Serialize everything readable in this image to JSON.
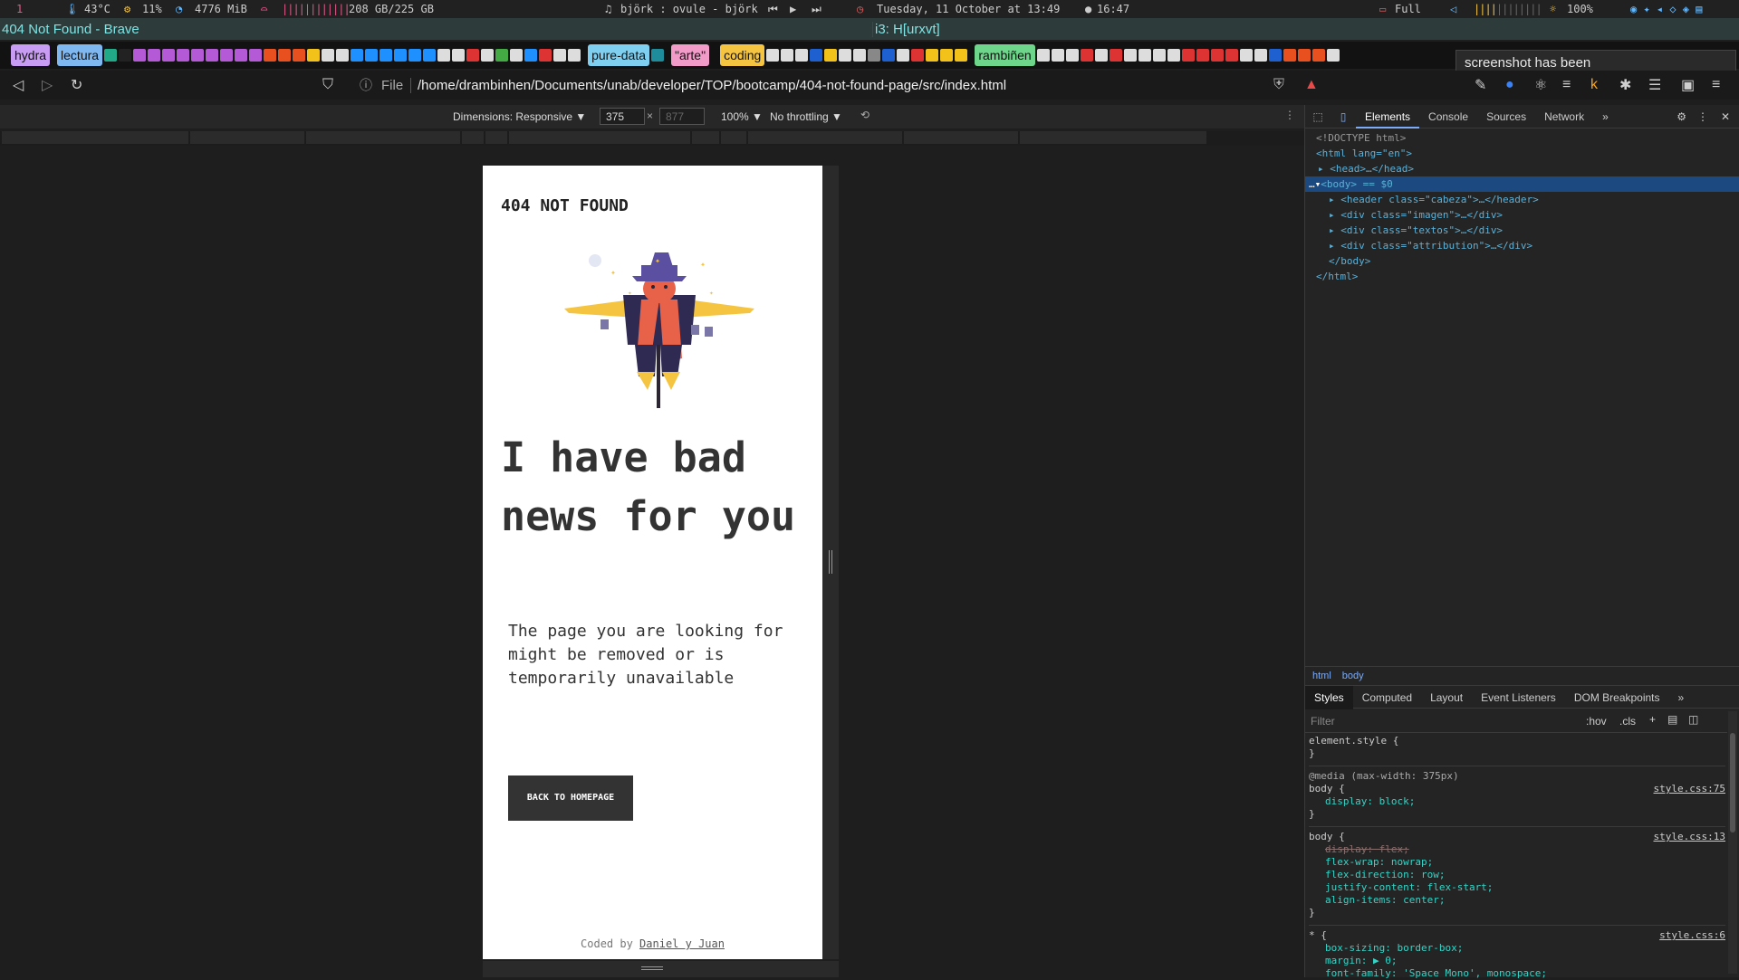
{
  "statusbar": {
    "workspace": "1",
    "temp": "43°C",
    "cpu": "11%",
    "mem": "4776 MiB",
    "disk": "208 GB/225 GB",
    "music": "björk : ovule - björk",
    "date": "Tuesday, 11 October at 13:49",
    "time": "16:47",
    "battery": "Full",
    "brightness": "100%"
  },
  "window": {
    "title": "404 Not Found - Brave",
    "i3": "i3: H[urxvt]"
  },
  "bookmarks": [
    "hydra",
    "lectura",
    "pure-data",
    "\"arte\"",
    "coding",
    "rambiñen"
  ],
  "toast": "screenshot has been s.../drambinhen/Pictures",
  "url": {
    "scheme": "File",
    "path": "/home/drambinhen/Documents/unab/developer/TOP/bootcamp/404-not-found-page/src/index.html"
  },
  "device_toolbar": {
    "dimensions": "Dimensions: Responsive ▼",
    "width": "375",
    "height_placeholder": "877",
    "zoom": "100% ▼",
    "throttle": "No throttling ▼"
  },
  "page": {
    "header": "404 NOT FOUND",
    "title": "I have bad news for you",
    "body": "The page you are looking for might be removed or is temporarily unavailable",
    "button": "BACK TO HOMEPAGE",
    "footer_prefix": "Coded by",
    "footer_link": "Daniel y Juan"
  },
  "devtools": {
    "tabs": [
      "Elements",
      "Console",
      "Sources",
      "Network"
    ],
    "dom": {
      "doctype": "<!DOCTYPE html>",
      "html_open": "<html lang=\"en\">",
      "head": "<head>…</head>",
      "body_open": "<body> == $0",
      "header_line": "<header class=\"cabeza\">…</header>",
      "div1": "<div class=\"imagen\">…</div>",
      "div2": "<div class=\"textos\">…</div>",
      "div3": "<div class=\"attribution\">…</div>",
      "body_close": "</body>",
      "html_close": "</html>"
    },
    "breadcrumb": [
      "html",
      "body"
    ],
    "styles_tabs": [
      "Styles",
      "Computed",
      "Layout",
      "Event Listeners",
      "DOM Breakpoints"
    ],
    "filter_placeholder": "Filter",
    "hov": ":hov",
    "cls": ".cls",
    "rules": {
      "element_style": "element.style {",
      "close": "}",
      "media": "@media (max-width: 375px)",
      "body_sel": "body {",
      "src75": "style.css:75",
      "src13": "style.css:13",
      "src6": "style.css:6",
      "r1": "display: block;",
      "r2_display": "display: flex;",
      "r2_wrap": "flex-wrap: nowrap;",
      "r2_dir": "flex-direction: row;",
      "r2_jc": "justify-content: flex-start;",
      "r2_ai": "align-items: center;",
      "star": "* {",
      "r3_box": "box-sizing: border-box;",
      "r3_margin": "margin: ▶ 0;",
      "r3_font": "font-family: 'Space Mono', monospace;"
    }
  }
}
